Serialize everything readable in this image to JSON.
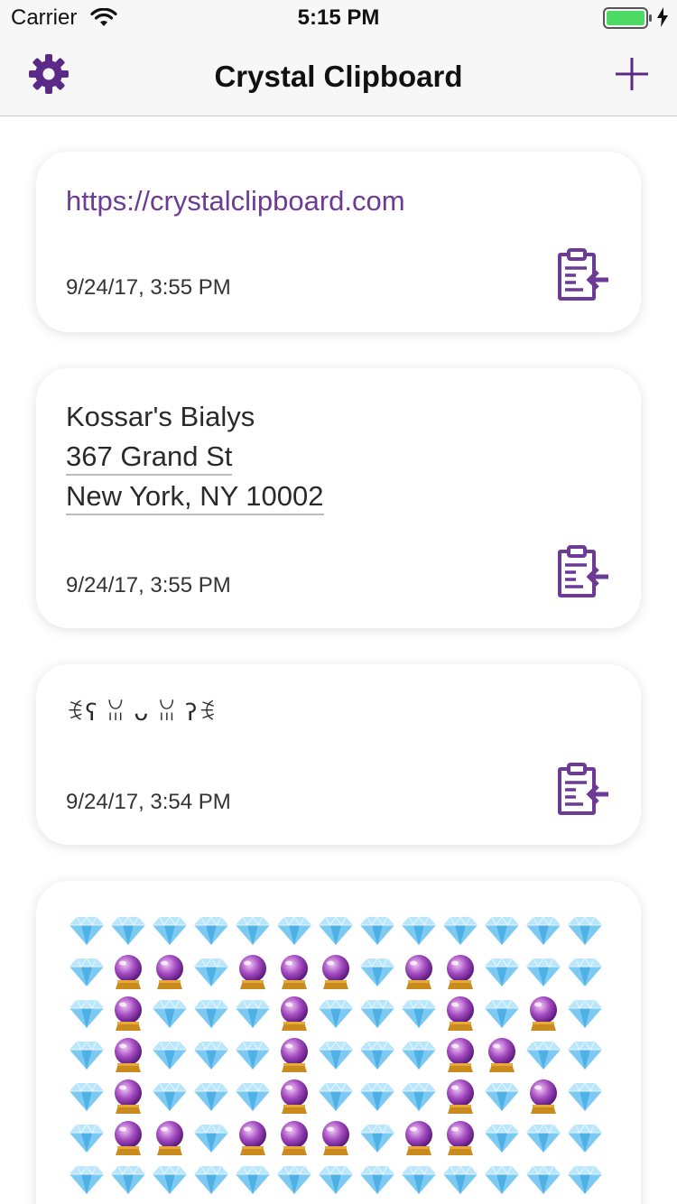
{
  "status_bar": {
    "carrier": "Carrier",
    "time": "5:15 PM",
    "battery_color": "#4cd964"
  },
  "nav": {
    "title": "Crystal Clipboard",
    "accent_color": "#5b2a86",
    "left_icon": "gear-icon",
    "right_icon": "plus-icon"
  },
  "clippings": [
    {
      "text": "https://crystalclipboard.com",
      "date": "9/24/17, 3:55 PM"
    },
    {
      "lines": [
        "Kossar's Bialys",
        "367 Grand St",
        "New York, NY 10002"
      ],
      "date": "9/24/17, 3:55 PM"
    },
    {
      "text": "ꉂʕ ꈍ ᴗ ꈍ ʔꉂ",
      "date": "9/24/17, 3:54 PM"
    },
    {
      "emoji_pattern": [
        "ddddddddddddd",
        "dccdcccdccddd",
        "dcdddcdddcdcd",
        "dcdddcdddccdd",
        "dcdddcdddcdcd",
        "dccdcccdccddd",
        "ddddddddddddd"
      ],
      "emoji_legend": {
        "d": "gem-emoji",
        "c": "crystal-ball-emoji"
      }
    }
  ]
}
